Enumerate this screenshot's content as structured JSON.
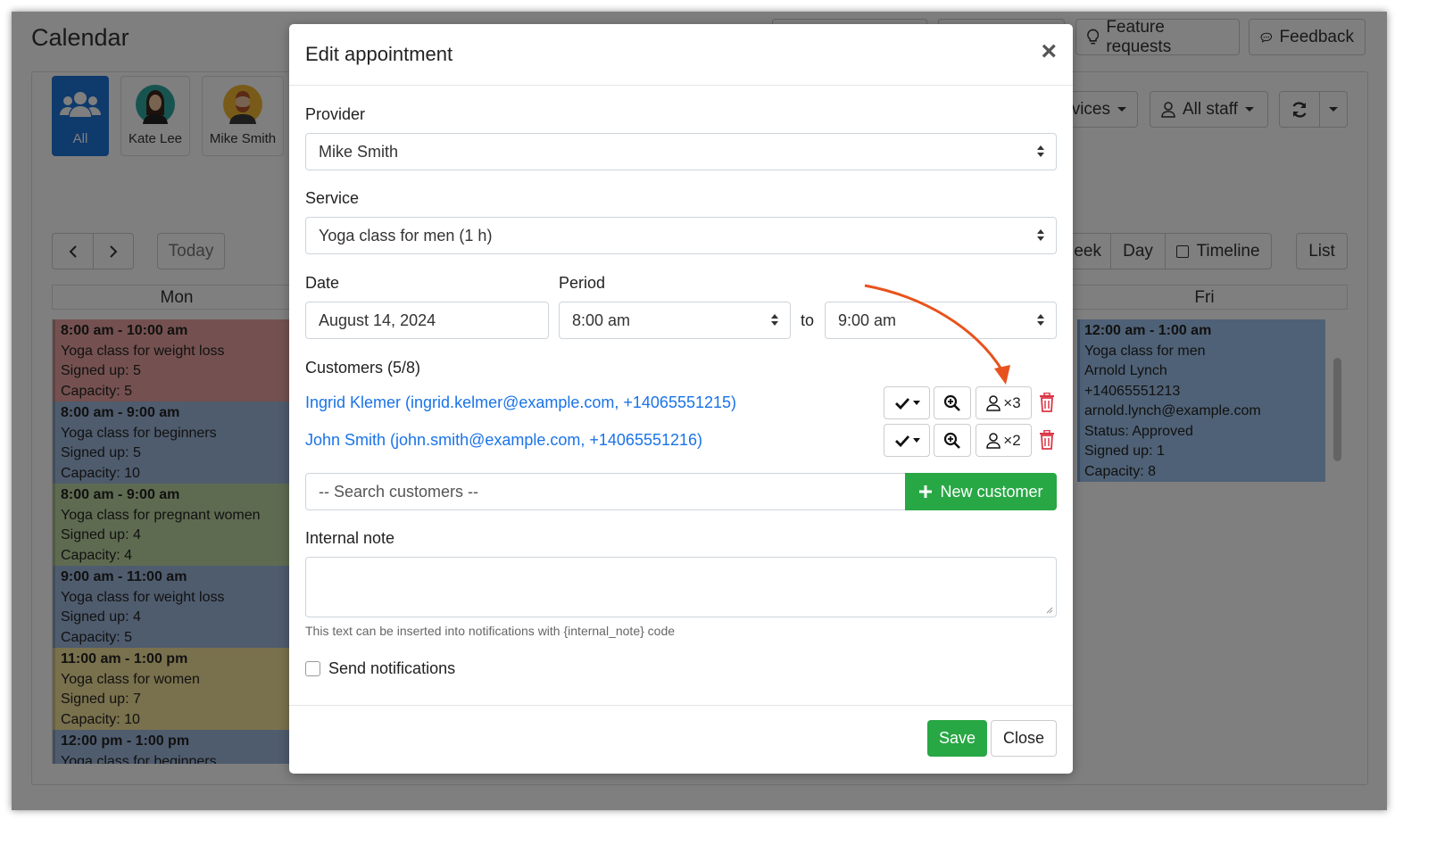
{
  "app": {
    "title": "Calendar",
    "top_buttons": {
      "feature_requests": "Feature requests",
      "feedback": "Feedback"
    },
    "filters": {
      "services_partial": "vices",
      "all_staff": "All staff"
    },
    "staff": [
      {
        "name": "All"
      },
      {
        "name": "Kate Lee"
      },
      {
        "name": "Mike Smith"
      }
    ],
    "nav": {
      "today": "Today",
      "week_partial": "eek",
      "day": "Day",
      "timeline": "Timeline",
      "list": "List"
    },
    "columns": {
      "mon": "Mon",
      "fri": "Fri"
    },
    "mon_events": [
      {
        "time": "8:00 am - 10:00 am",
        "title": "Yoga class for weight loss",
        "signed": "Signed up: 5",
        "capacity": "Capacity: 5",
        "color": "#e8a3a0"
      },
      {
        "time": "8:00 am - 9:00 am",
        "title": "Yoga class for beginners",
        "signed": "Signed up: 5",
        "capacity": "Capacity: 10",
        "color": "#9fb9dc"
      },
      {
        "time": "8:00 am - 9:00 am",
        "title": "Yoga class for pregnant women",
        "signed": "Signed up: 4",
        "capacity": "Capacity: 4",
        "color": "#bfd7a2"
      },
      {
        "time": "9:00 am - 11:00 am",
        "title": "Yoga class for weight loss",
        "signed": "Signed up: 4",
        "capacity": "Capacity: 5",
        "color": "#9fb9dc"
      },
      {
        "time": "11:00 am - 1:00 pm",
        "title": "Yoga class for women",
        "signed": "Signed up: 7",
        "capacity": "Capacity: 10",
        "color": "#f2e29a"
      },
      {
        "time": "12:00 pm - 1:00 pm",
        "title": "Yoga class for beginners",
        "signed": "",
        "capacity": "",
        "color": "#9fb9dc"
      }
    ],
    "fri_event": {
      "time": "12:00 am - 1:00 am",
      "title": "Yoga class for men",
      "customer": "Arnold Lynch",
      "phone": "+14065551213",
      "email": "arnold.lynch@example.com",
      "status": "Status: Approved",
      "signed": "Signed up: 1",
      "capacity": "Capacity: 8"
    }
  },
  "modal": {
    "title": "Edit appointment",
    "provider_label": "Provider",
    "provider_value": "Mike Smith",
    "service_label": "Service",
    "service_value": "Yoga class for men (1 h)",
    "date_label": "Date",
    "date_value": "August 14, 2024",
    "period_label": "Period",
    "period_start": "8:00 am",
    "period_to": "to",
    "period_end": "9:00 am",
    "customers_label": "Customers (5/8)",
    "customers": [
      {
        "text": "Ingrid Klemer (ingrid.kelmer@example.com, +14065551215)",
        "count": "×3"
      },
      {
        "text": "John Smith (john.smith@example.com, +14065551216)",
        "count": "×2"
      }
    ],
    "search_placeholder": "-- Search customers --",
    "new_customer": "New customer",
    "note_label": "Internal note",
    "note_help": "This text can be inserted into notifications with {internal_note} code",
    "send_notifications": "Send notifications",
    "save": "Save",
    "close": "Close"
  },
  "colors": {
    "primary": "#1f74d8",
    "success": "#28a745",
    "link": "#1a73e8",
    "danger": "#dc3545",
    "arrow": "#e8521c"
  }
}
